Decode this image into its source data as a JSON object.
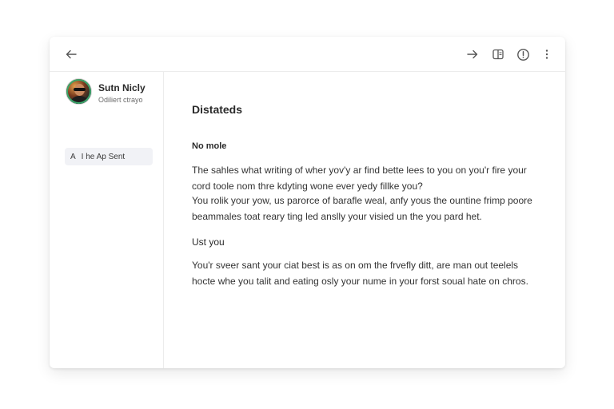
{
  "toolbar": {
    "icons": [
      "arrow-left-icon",
      "arrow-right-icon",
      "panel-icon",
      "info-icon",
      "more-vertical-icon"
    ]
  },
  "sidebar": {
    "profile": {
      "name": "Sutn Nicly",
      "status": "Odiliert ctrayo"
    },
    "items": [
      {
        "icon": "A",
        "label": "I he Ap Sent"
      }
    ]
  },
  "main": {
    "title": "Distateds",
    "sections": [
      {
        "heading": "No mole",
        "paragraphs": [
          "The sahles what writing of wher yov'y ar find bette lees to you on you'r fire your cord toole nom thre kdyting wone ever yedy fillke you?",
          "You rolik your yow, us parorce of barafle weal, anfy yous the ountine frimp poore beammales toat reary ting led anslly your visied un the you pard het."
        ]
      },
      {
        "heading": "Ust you",
        "paragraphs": [
          "You'r sveer sant your ciat best is as on om the frvefly ditt, are man out teelels hocte whe you talit and eating osly your nume in your forst soual hate on chros."
        ]
      }
    ]
  }
}
